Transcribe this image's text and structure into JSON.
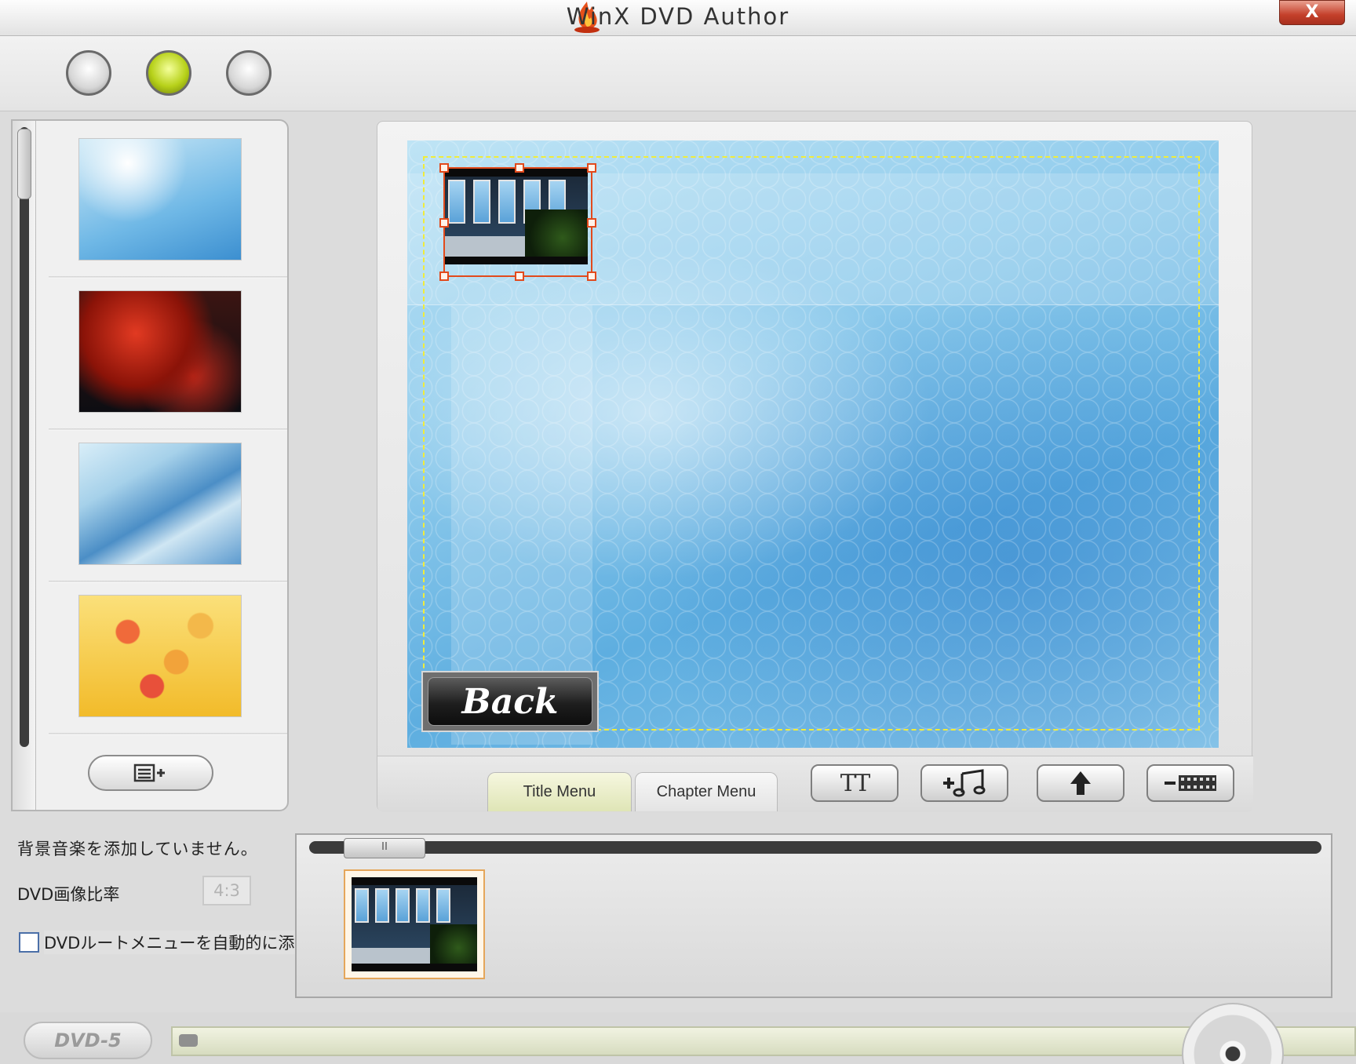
{
  "window": {
    "title": "WinX DVD Author",
    "close_label": "X"
  },
  "steps": [
    {
      "name": "step-1",
      "active": false
    },
    {
      "name": "step-2",
      "active": true
    },
    {
      "name": "step-3",
      "active": false
    }
  ],
  "templates": [
    {
      "name": "blue-sparkle"
    },
    {
      "name": "red-roses"
    },
    {
      "name": "blue-wave"
    },
    {
      "name": "yellow-roses"
    }
  ],
  "menu_tabs": {
    "title_menu": "Title Menu",
    "chapter_menu": "Chapter Menu",
    "active": "title_menu"
  },
  "preview": {
    "back_button_label": "Back"
  },
  "tools": {
    "text_icon_label": "TT"
  },
  "settings": {
    "bgm_status": "背景音楽を添加していません。",
    "ratio_label": "DVD画像比率",
    "ratio_value": "4:3",
    "root_menu_label": "DVDルートメニューを自動的に添加する",
    "root_menu_checked": false
  },
  "status": {
    "disc_type": "DVD-5"
  },
  "colors": {
    "active_step": "#b7d11a",
    "selection": "#e24a1c",
    "safe_area": "#f0ec3a"
  }
}
